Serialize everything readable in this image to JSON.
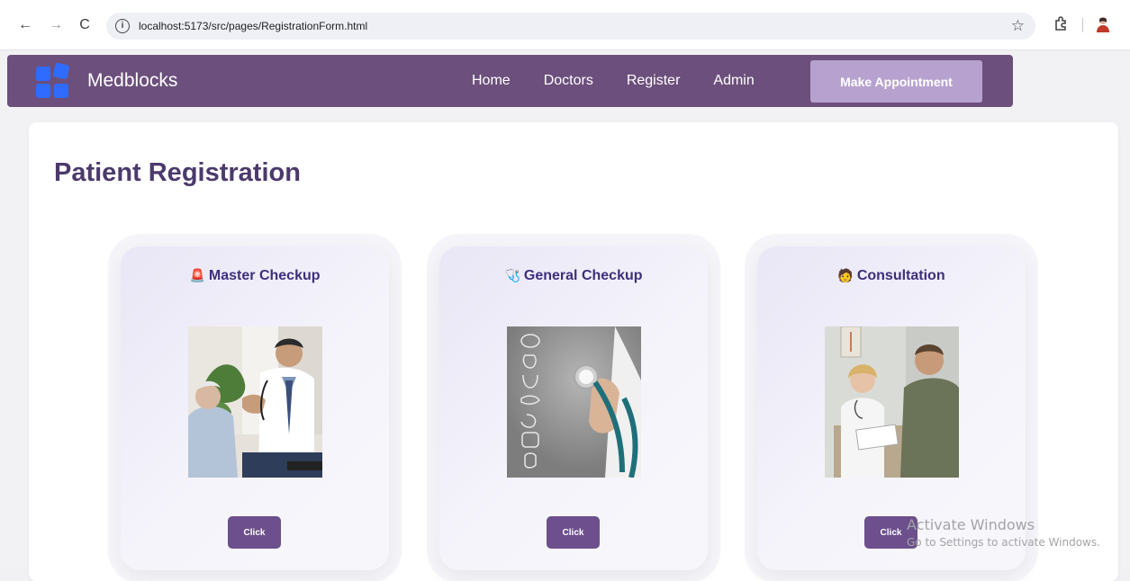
{
  "browser": {
    "url": "localhost:5173/src/pages/RegistrationForm.html",
    "back_icon": "←",
    "forward_icon": "→",
    "reload_icon": "C"
  },
  "navbar": {
    "brand": "Medblocks",
    "links": [
      {
        "label": "Home"
      },
      {
        "label": "Doctors"
      },
      {
        "label": "Register"
      },
      {
        "label": "Admin"
      }
    ],
    "cta_label": "Make Appointment",
    "accent_color": "#6c4f7c",
    "logo_color": "#2f6bff"
  },
  "main": {
    "title": "Patient Registration",
    "cards": [
      {
        "emoji": "🚨",
        "title": "Master Checkup",
        "button": "Click"
      },
      {
        "emoji": "🩺",
        "title": "General Checkup",
        "button": "Click"
      },
      {
        "emoji": "🧑",
        "title": "Consultation",
        "button": "Click"
      }
    ]
  },
  "watermark": {
    "line1": "Activate Windows",
    "line2": "Go to Settings to activate Windows."
  }
}
